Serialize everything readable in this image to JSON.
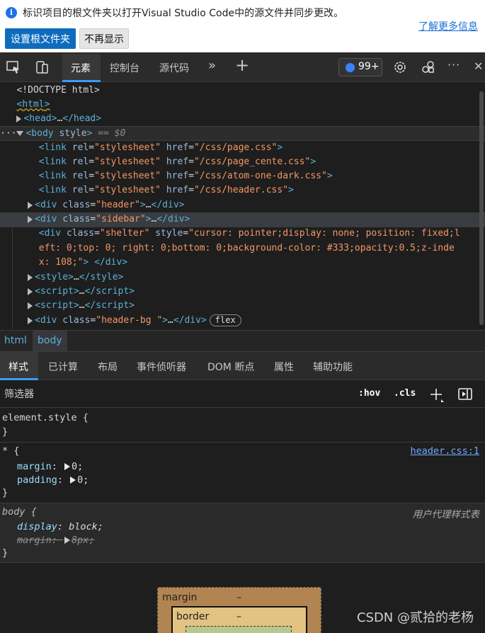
{
  "infobar": {
    "message": "标识项目的根文件夹以打开Visual Studio Code中的源文件并同步更改。",
    "learn_more": "了解更多信息",
    "set_root_button": "设置根文件夹",
    "dont_show_button": "不再显示"
  },
  "toolbar": {
    "tabs": [
      "元素",
      "控制台",
      "源代码"
    ],
    "more": "»",
    "add": "+",
    "issues_count": "99+",
    "ellipsis": "···",
    "close": "✕"
  },
  "dom": {
    "lines": [
      {
        "text": "<!DOCTYPE html>"
      },
      {
        "tag": "html"
      },
      {
        "open": "<head>",
        "mid": "…",
        "close": "</head>"
      },
      {
        "prefix": "···",
        "open": "<body",
        "attr": "style",
        "close": ">",
        "eq": "== $0"
      },
      {
        "attr_rel": "rel",
        "val_rel": "\"stylesheet\"",
        "attr_href": "href",
        "val_href": "\"/css/page.css\""
      },
      {
        "attr_rel": "rel",
        "val_rel": "\"stylesheet\"",
        "attr_href": "href",
        "val_href": "\"/css/page_cente.css\""
      },
      {
        "attr_rel": "rel",
        "val_rel": "\"stylesheet\"",
        "attr_href": "href",
        "val_href": "\"/css/atom-one-dark.css\""
      },
      {
        "attr_rel": "rel",
        "val_rel": "\"stylesheet\"",
        "attr_href": "href",
        "val_href": "\"/css/header.css\""
      },
      {
        "cls": "\"header\""
      },
      {
        "cls": "\"sidebar\""
      },
      {
        "shelter_1": "\"cursor: pointer;display: none; position: fixed;l",
        "shelter_2": "eft: 0;top: 0; right: 0;bottom: 0;background-color: #333;opacity:0.5;z-inde",
        "shelter_3": "x: 108;\""
      },
      {
        "tag": "style"
      },
      {
        "tag": "script"
      },
      {
        "tag": "script"
      },
      {
        "cls": "\"header-bg \"",
        "pill": "flex"
      }
    ]
  },
  "breadcrumb": [
    "html",
    "body"
  ],
  "style_tabs": [
    "样式",
    "已计算",
    "布局",
    "事件侦听器",
    "DOM 断点",
    "属性",
    "辅助功能"
  ],
  "filter": {
    "placeholder": "筛选器",
    "hov": ":hov",
    ".cls": ".cls"
  },
  "rules": {
    "element_style": {
      "selector": "element.style {",
      "close": "}"
    },
    "star": {
      "selector": "* {",
      "source": "header.css:1",
      "props": [
        {
          "name": "margin",
          "value": "0;"
        },
        {
          "name": "padding",
          "value": "0;"
        }
      ],
      "close": "}"
    },
    "body": {
      "selector": "body {",
      "source": "用户代理样式表",
      "props": [
        {
          "name": "display",
          "value": "block;"
        },
        {
          "name": "margin",
          "value": "8px;"
        }
      ],
      "close": "}"
    }
  },
  "box_model": {
    "margin_label": "margin",
    "margin_value": "–",
    "border_label": "border",
    "border_value": "–"
  },
  "watermark": "CSDN @贰拾的老杨"
}
